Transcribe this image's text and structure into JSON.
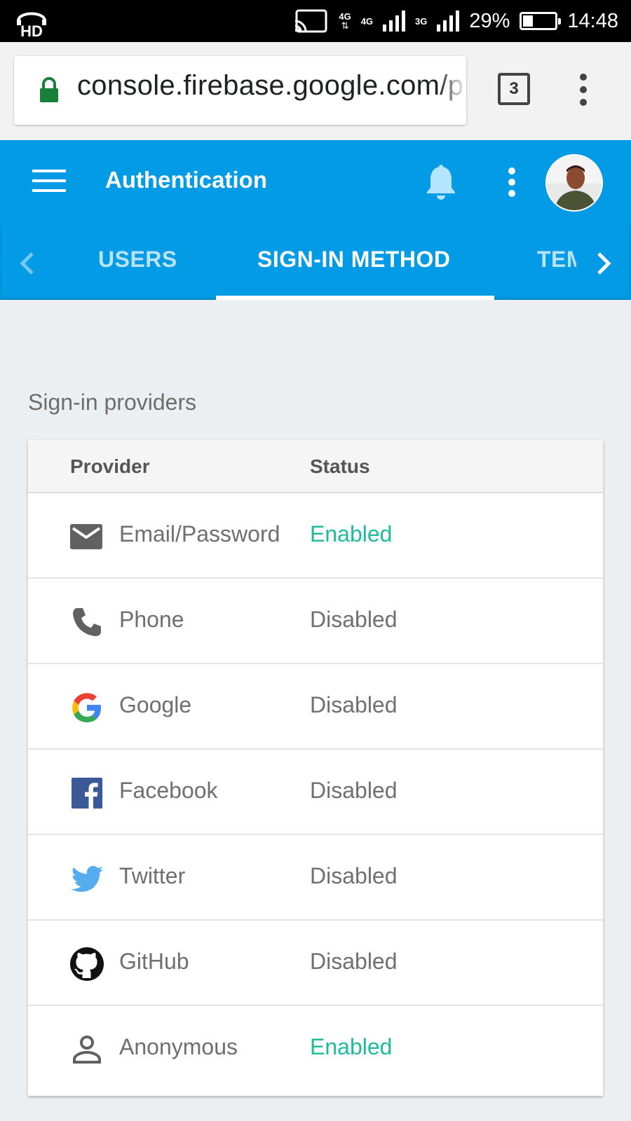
{
  "status_bar": {
    "hd_label": "HD",
    "network_4g_small": "4G",
    "network_4g": "4G",
    "network_3g": "3G",
    "battery_percent_text": "29%",
    "battery_level": 0.29,
    "time": "14:48"
  },
  "browser": {
    "url": "console.firebase.google.com/p",
    "tab_count": "3",
    "icons": {
      "lock": "lock-icon",
      "menu": "more-vert-icon"
    },
    "colors": {
      "lock": "#188038"
    }
  },
  "header": {
    "title": "Authentication",
    "icons": {
      "menu": "hamburger-icon",
      "notifications": "bell-icon",
      "more": "more-vert-icon",
      "avatar": "avatar"
    },
    "colors": {
      "background": "#039be5"
    }
  },
  "tabs": [
    {
      "label": "USERS",
      "selected": false
    },
    {
      "label": "SIGN-IN METHOD",
      "selected": true
    },
    {
      "label": "TEMPLATES",
      "selected": false
    }
  ],
  "content": {
    "section_title": "Sign-in providers",
    "table": {
      "columns": [
        "Provider",
        "Status"
      ],
      "rows": [
        {
          "icon": "email-icon",
          "provider": "Email/Password",
          "status": "Enabled"
        },
        {
          "icon": "phone-icon",
          "provider": "Phone",
          "status": "Disabled"
        },
        {
          "icon": "google-icon",
          "provider": "Google",
          "status": "Disabled"
        },
        {
          "icon": "facebook-icon",
          "provider": "Facebook",
          "status": "Disabled"
        },
        {
          "icon": "twitter-icon",
          "provider": "Twitter",
          "status": "Disabled"
        },
        {
          "icon": "github-icon",
          "provider": "GitHub",
          "status": "Disabled"
        },
        {
          "icon": "anonymous-icon",
          "provider": "Anonymous",
          "status": "Enabled"
        }
      ]
    },
    "colors": {
      "enabled": "#1fbc9c",
      "disabled": "#6f6f6f"
    }
  }
}
